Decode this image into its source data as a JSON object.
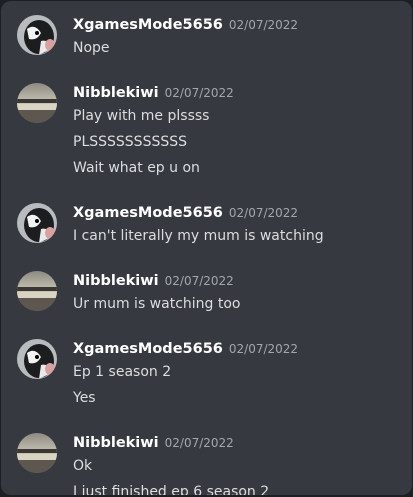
{
  "messages": [
    {
      "username": "XgamesMode5656",
      "timestamp": "02/07/2022",
      "avatar": "cow-avatar",
      "lines": [
        "Nope"
      ]
    },
    {
      "username": "Nibblekiwi",
      "timestamp": "02/07/2022",
      "avatar": "landscape-avatar",
      "lines": [
        "Play with me plssss",
        "PLSSSSSSSSSSS",
        "Wait what ep u on"
      ]
    },
    {
      "username": "XgamesMode5656",
      "timestamp": "02/07/2022",
      "avatar": "cow-avatar",
      "lines": [
        "I can't literally my mum is watching"
      ]
    },
    {
      "username": "Nibblekiwi",
      "timestamp": "02/07/2022",
      "avatar": "landscape-avatar",
      "lines": [
        "Ur mum is watching too"
      ]
    },
    {
      "username": "XgamesMode5656",
      "timestamp": "02/07/2022",
      "avatar": "cow-avatar",
      "lines": [
        "Ep 1 season 2",
        "Yes"
      ]
    },
    {
      "username": "Nibblekiwi",
      "timestamp": "02/07/2022",
      "avatar": "landscape-avatar",
      "lines": [
        "Ok",
        "I just finished ep 6 season 2"
      ]
    }
  ],
  "colors": {
    "background": "#36393f",
    "username": "#ffffff",
    "timestamp": "#a3a6aa",
    "message_text": "#dcddde"
  }
}
